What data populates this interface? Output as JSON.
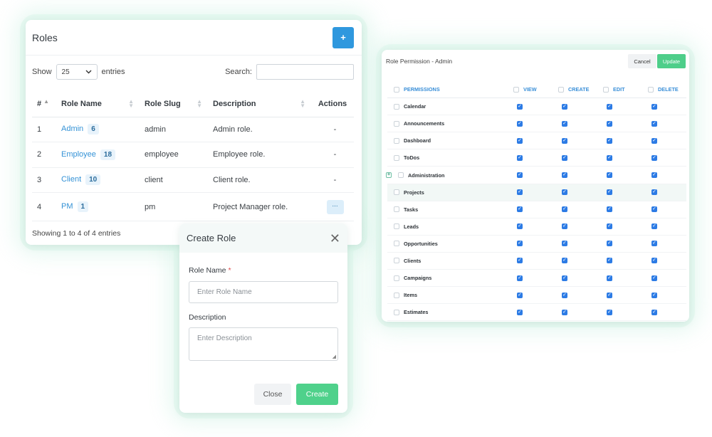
{
  "roles_card": {
    "title": "Roles",
    "add_label": "+",
    "show_label": "Show",
    "page_size": "25",
    "entries_label": "entries",
    "search_label": "Search:",
    "columns": [
      "#",
      "Role Name",
      "Role Slug",
      "Description",
      "Actions"
    ],
    "rows": [
      {
        "num": "1",
        "name": "Admin",
        "count": "6",
        "slug": "admin",
        "description": "Admin role.",
        "action": "-"
      },
      {
        "num": "2",
        "name": "Employee",
        "count": "18",
        "slug": "employee",
        "description": "Employee role.",
        "action": "-"
      },
      {
        "num": "3",
        "name": "Client",
        "count": "10",
        "slug": "client",
        "description": "Client role.",
        "action": "-"
      },
      {
        "num": "4",
        "name": "PM",
        "count": "1",
        "slug": "pm",
        "description": "Project Manager role.",
        "action": "..."
      }
    ],
    "footer": "Showing 1 to 4 of 4 entries"
  },
  "permission_card": {
    "title": "Role Permission - Admin",
    "cancel_label": "Cancel",
    "update_label": "Update",
    "columns": [
      "PERMISSIONS",
      "VIEW",
      "CREATE",
      "EDIT",
      "DELETE"
    ],
    "rows": [
      {
        "name": "Calendar"
      },
      {
        "name": "Announcements"
      },
      {
        "name": "Dashboard"
      },
      {
        "name": "ToDos"
      },
      {
        "name": "Administration",
        "expandable": true
      },
      {
        "name": "Projects",
        "highlighted": true
      },
      {
        "name": "Tasks"
      },
      {
        "name": "Leads"
      },
      {
        "name": "Opportunities"
      },
      {
        "name": "Clients"
      },
      {
        "name": "Campaigns"
      },
      {
        "name": "Items"
      },
      {
        "name": "Estimates"
      }
    ]
  },
  "create_modal": {
    "title": "Create Role",
    "close_label": "✕",
    "role_name_label": "Role Name",
    "required_mark": "*",
    "role_name_placeholder": "Enter Role Name",
    "description_label": "Description",
    "description_placeholder": "Enter Description",
    "cancel_label": "Close",
    "create_label": "Create"
  },
  "colors": {
    "primary_blue": "#2f98de",
    "success_green": "#4fd18b",
    "checkbox_blue": "#2c7be5"
  }
}
